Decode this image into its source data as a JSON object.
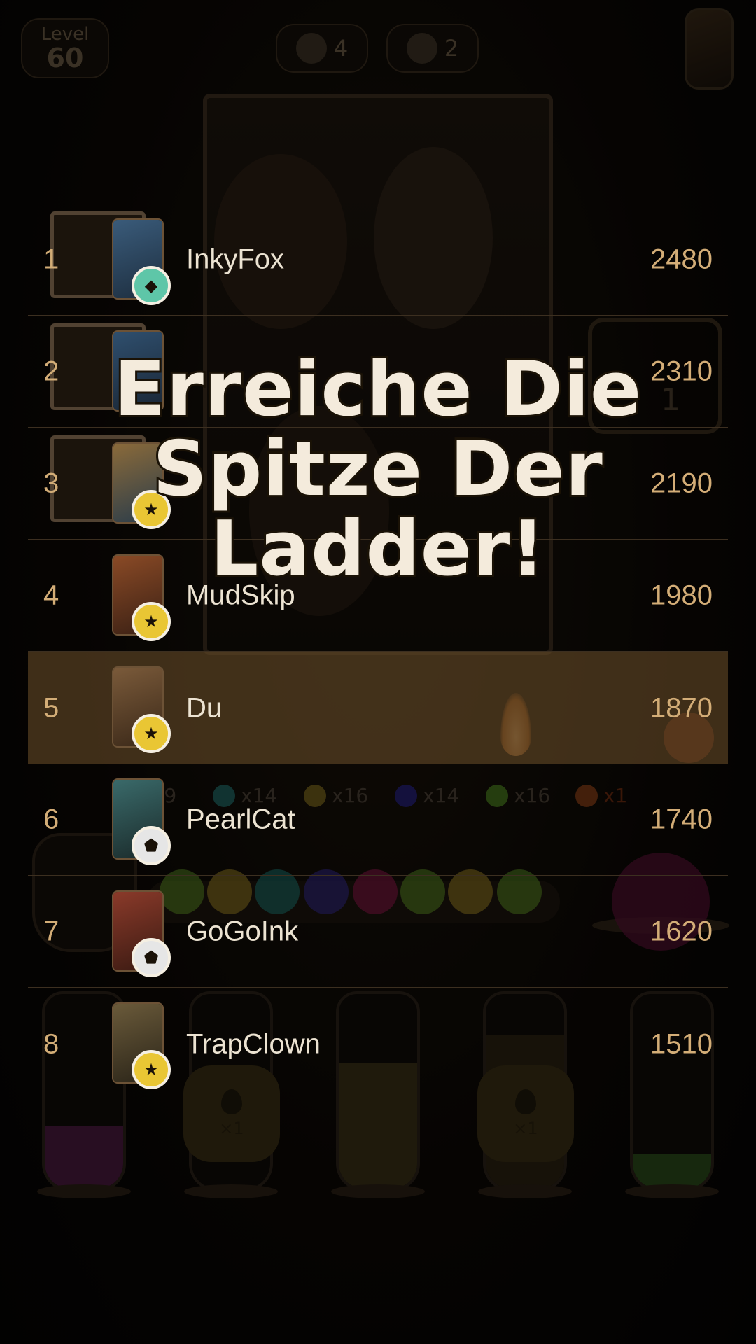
{
  "top_bar": {
    "level_label": "Level",
    "level_value": "60",
    "counter_a": "4",
    "counter_b": "2"
  },
  "hint_box": {
    "value": "1"
  },
  "color_counters": [
    {
      "label": "x19",
      "color": "#2c6e7a"
    },
    {
      "label": "x14",
      "color": "#1f8c86"
    },
    {
      "label": "x16",
      "color": "#b89a2c"
    },
    {
      "label": "x14",
      "color": "#3a2fa8"
    },
    {
      "label": "x16",
      "color": "#6aa82a"
    },
    {
      "label": "x1",
      "color": "#c0581c"
    }
  ],
  "drop_tokens": [
    "×1",
    "×1"
  ],
  "headline": {
    "line1": "Erreiche Die",
    "line2": "Spitze Der",
    "line3": "Ladder!"
  },
  "leaderboard": [
    {
      "rank": "1",
      "name": "InkyFox",
      "score": "2480",
      "badge": "diamond",
      "badge_color": "#5ec6a8",
      "art": [
        "#3a5b7a",
        "#1d2e3f"
      ]
    },
    {
      "rank": "2",
      "name": "",
      "score": "2310",
      "badge": "diamond",
      "badge_color": "#5ec6a8",
      "art": [
        "#2f4f6e",
        "#1a2635"
      ]
    },
    {
      "rank": "3",
      "name": "",
      "score": "2190",
      "badge": "star",
      "badge_color": "#e9c634",
      "art": [
        "#8a6a3a",
        "#2a3c4a"
      ]
    },
    {
      "rank": "4",
      "name": "MudSkip",
      "score": "1980",
      "badge": "star",
      "badge_color": "#e9c634",
      "art": [
        "#8a4a26",
        "#3a2014"
      ]
    },
    {
      "rank": "5",
      "name": "Du",
      "score": "1870",
      "badge": "star",
      "badge_color": "#e9c634",
      "art": [
        "#7a5a3a",
        "#3a2818"
      ],
      "is_me": true
    },
    {
      "rank": "6",
      "name": "PearlCat",
      "score": "1740",
      "badge": "shield",
      "badge_color": "#e6e6e6",
      "art": [
        "#3a6a6a",
        "#1a2a2a"
      ]
    },
    {
      "rank": "7",
      "name": "GoGoInk",
      "score": "1620",
      "badge": "shield",
      "badge_color": "#e6e6e6",
      "art": [
        "#8a3a2a",
        "#3a1a12"
      ]
    },
    {
      "rank": "8",
      "name": "TrapClown",
      "score": "1510",
      "badge": "star",
      "badge_color": "#e9c634",
      "art": [
        "#6a5a3a",
        "#2a2418"
      ]
    }
  ],
  "badge_glyphs": {
    "diamond": "◆",
    "star": "★",
    "shield": "⬟"
  }
}
